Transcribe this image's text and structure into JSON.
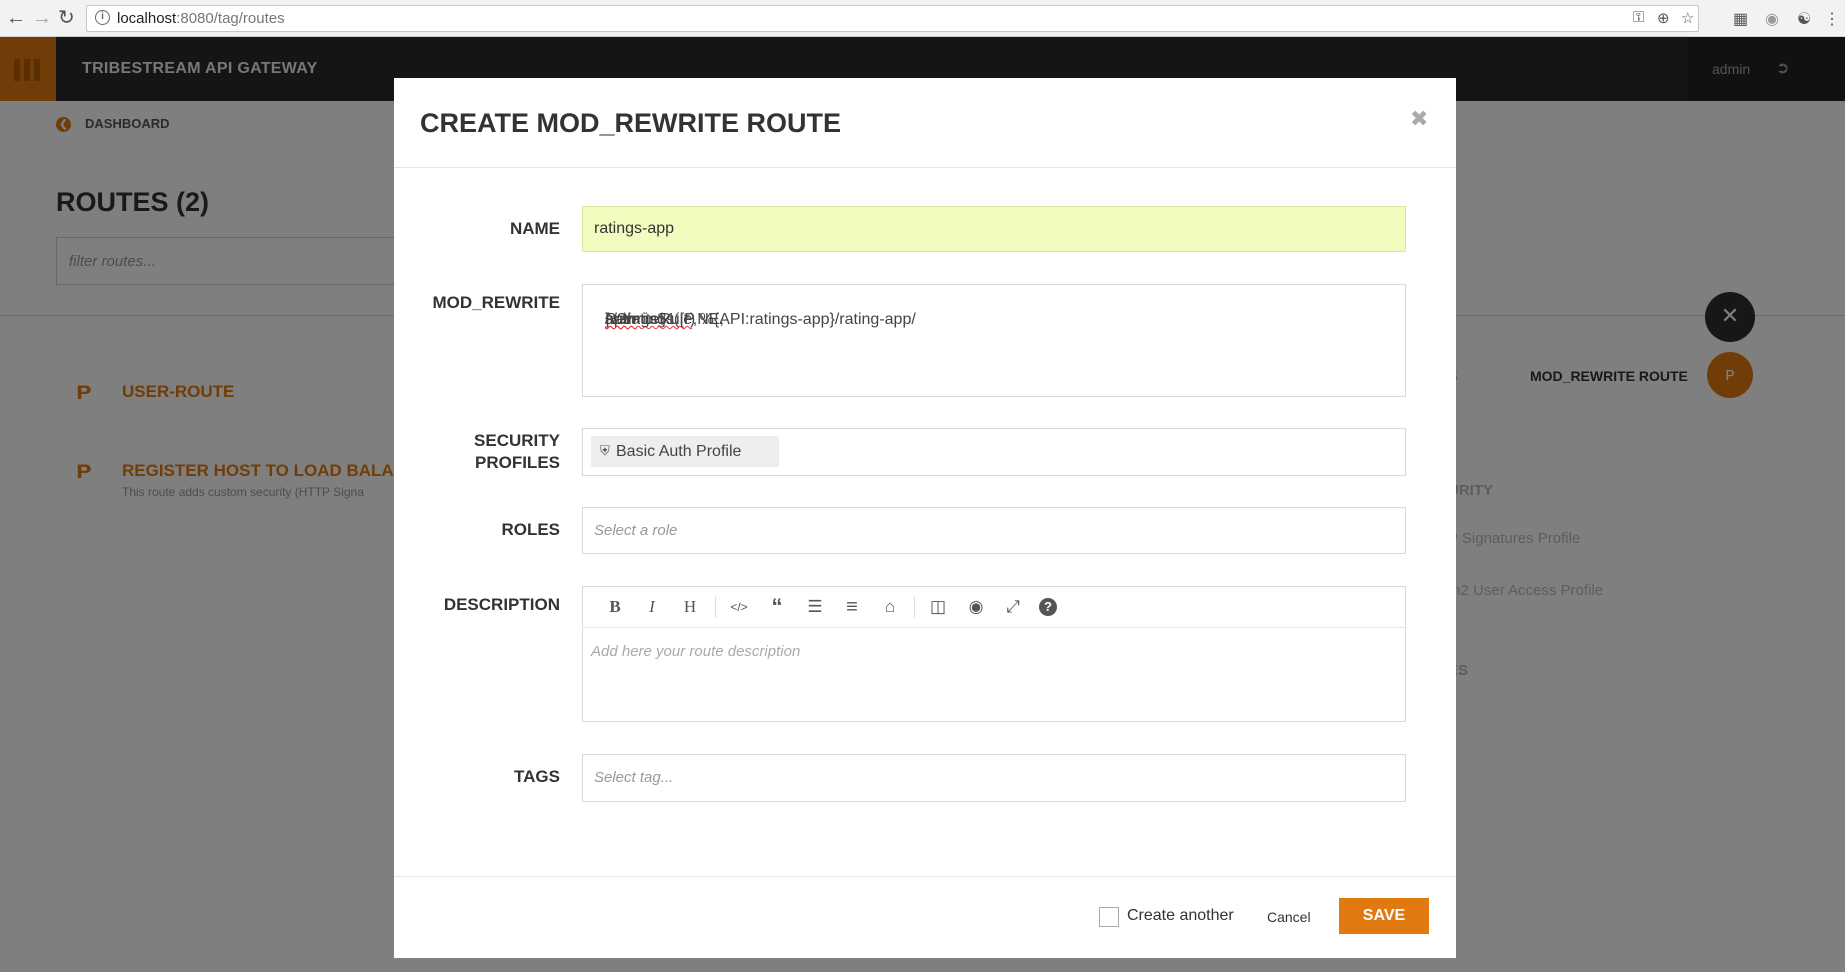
{
  "browser": {
    "url_host": "localhost",
    "url_rest": ":8080/tag/routes"
  },
  "app": {
    "brand": "TRIBESTREAM API GATEWAY",
    "user": "admin",
    "breadcrumb": "DASHBOARD",
    "page_title": "ROUTES (2)",
    "filter_placeholder": "filter routes...",
    "routes": [
      {
        "name": "USER-ROUTE",
        "description": ""
      },
      {
        "name": "REGISTER HOST TO LOAD BALA",
        "description": "This route adds custom security (HTTP Signa"
      }
    ],
    "fab_label": "MOD_REWRITE ROUTE",
    "side": {
      "s_fragment": "S",
      "security_fragment": "URITY",
      "profile1_fragment": "P Signatures Profile",
      "profile2_fragment": "th2 User Access Profile",
      "es_fragment": "ES"
    }
  },
  "modal": {
    "title": "CREATE MOD_REWRITE ROUTE",
    "labels": {
      "name": "NAME",
      "mod_rewrite": "MOD_REWRITE",
      "security_line1": "SECURITY",
      "security_line2": "PROFILES",
      "roles": "ROLES",
      "description": "DESCRIPTION",
      "tags": "TAGS"
    },
    "name_value": "ratings-app",
    "rewrite": {
      "p1": "RewriteRule",
      "p2": " ^/?ratings(.*) %{API:ratings-app}/rating-app/",
      "p3": "api",
      "p4": "/ratings$1 [P,NE,",
      "p5": "auth",
      "p6": "]"
    },
    "security_profile": "Basic Auth Profile",
    "roles_placeholder": "Select a role",
    "description_placeholder": "Add here your route description",
    "tags_placeholder": "Select tag...",
    "toolbar_icons": {
      "bold": "B",
      "italic": "I",
      "heading": "H",
      "code": "</>",
      "quote": "“",
      "ul": "☰",
      "ol": "≡",
      "eraser": "⌂",
      "preview_side": "◫",
      "preview": "◉",
      "fullscreen": "⤢",
      "help": "?"
    },
    "create_another": "Create another",
    "cancel": "Cancel",
    "save": "SAVE"
  }
}
